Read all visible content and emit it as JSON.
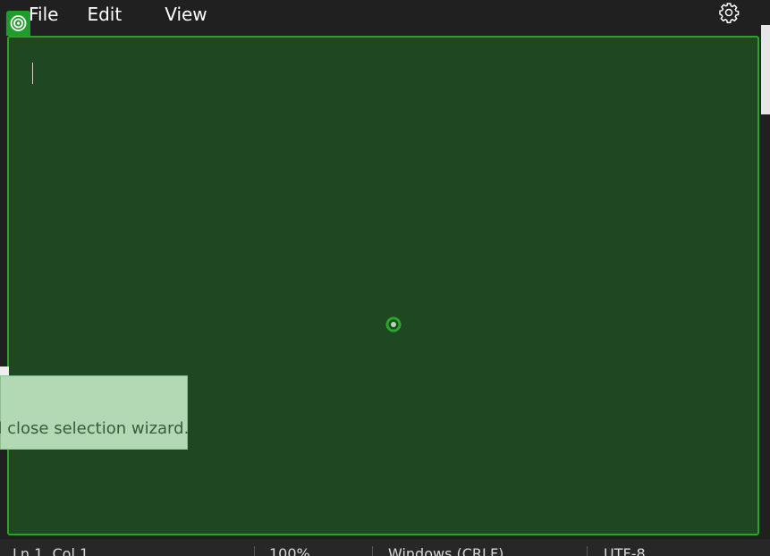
{
  "menu": {
    "items": [
      {
        "label": "File"
      },
      {
        "label": "Edit"
      },
      {
        "label": "View"
      }
    ]
  },
  "icons": {
    "settings": "gear-icon",
    "badge": "target-icon",
    "center": "crosshair-icon"
  },
  "tooltip": {
    "text": "d close selection wizard."
  },
  "status": {
    "position": "Ln 1, Col 1",
    "zoom": "100%",
    "line_ending": "Windows (CRLF)",
    "encoding": "UTF-8"
  },
  "colors": {
    "overlay_fill": "#1f4722",
    "overlay_border": "#2aa32a",
    "tooltip_bg": "#b2d9b3"
  }
}
